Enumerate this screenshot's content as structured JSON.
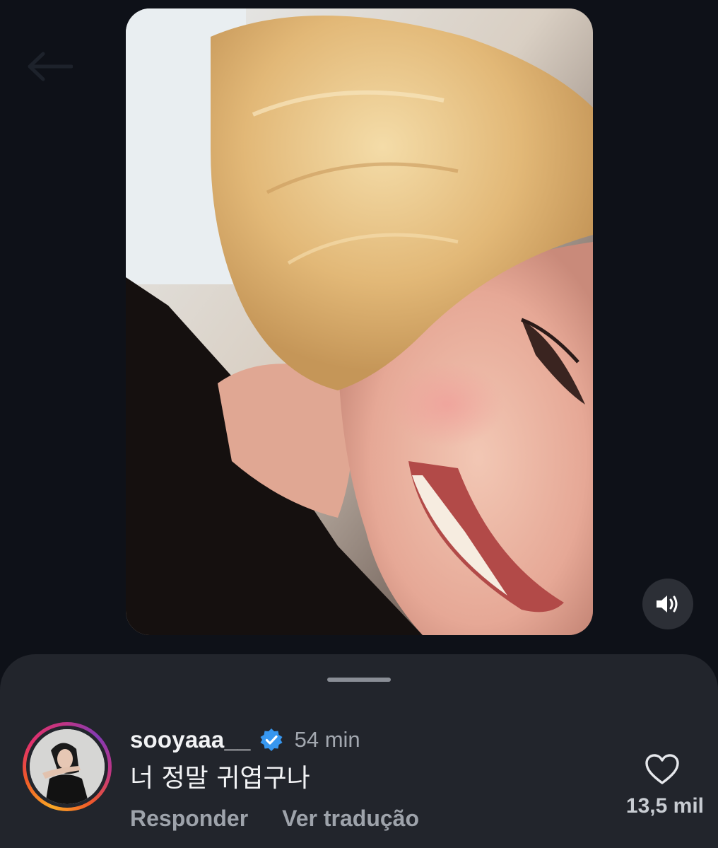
{
  "header": {
    "back_icon": "arrow-left-icon"
  },
  "video": {
    "sound_icon": "speaker-on-icon"
  },
  "comment": {
    "username": "sooyaaa__",
    "verified_icon": "verified-badge-icon",
    "time": "54 min",
    "text": "너 정말 귀엽구나",
    "reply_label": "Responder",
    "translate_label": "Ver tradução",
    "like_icon": "heart-outline-icon",
    "like_count": "13,5 mil"
  },
  "colors": {
    "background": "#0e1118",
    "sheet": "#22252c",
    "verified_blue": "#3797f0",
    "muted_text": "#9ea3ab"
  }
}
